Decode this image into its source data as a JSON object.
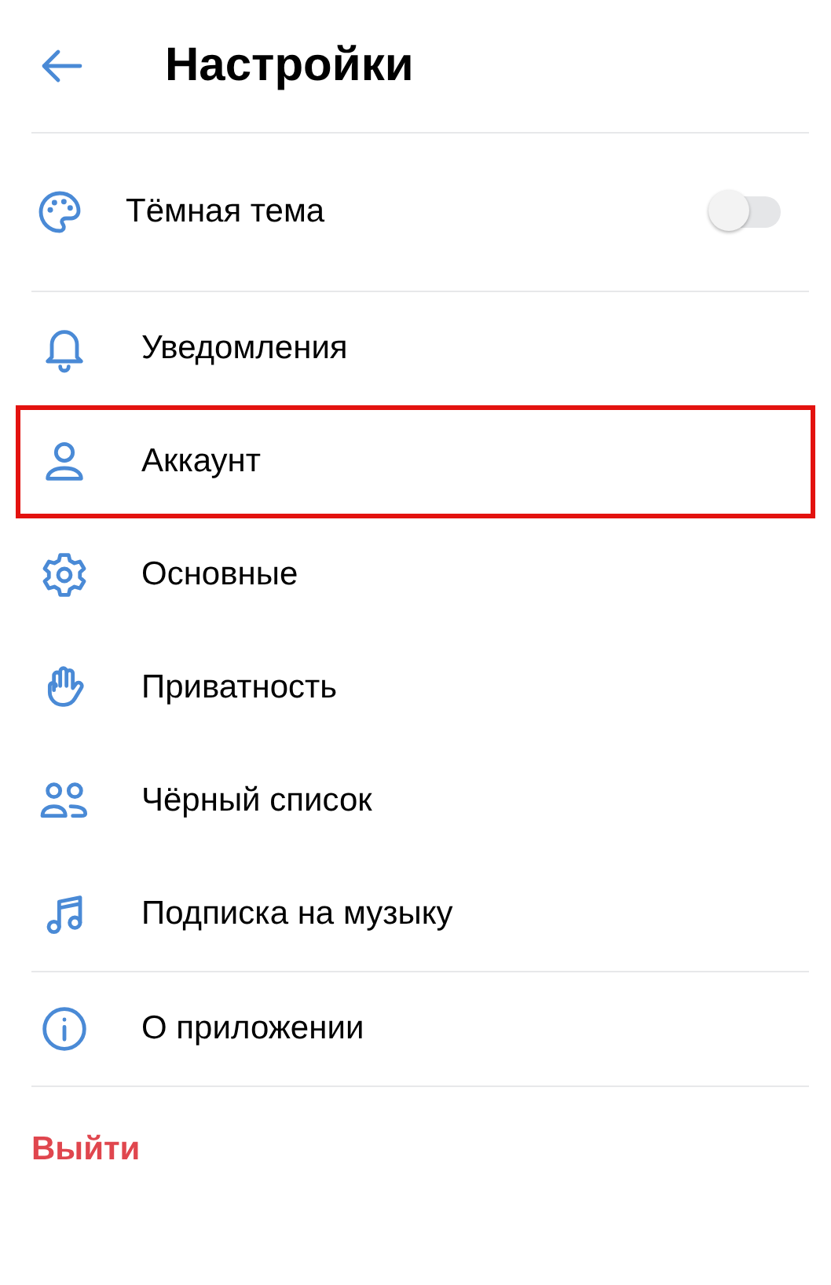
{
  "header": {
    "title": "Настройки"
  },
  "theme_row": {
    "label": "Тёмная тема",
    "on": false
  },
  "menu": [
    {
      "kind": "bell",
      "label": "Уведомления",
      "highlighted": false
    },
    {
      "kind": "person",
      "label": "Аккаунт",
      "highlighted": true
    },
    {
      "kind": "gear",
      "label": "Основные",
      "highlighted": false
    },
    {
      "kind": "hand",
      "label": "Приватность",
      "highlighted": false
    },
    {
      "kind": "people",
      "label": "Чёрный список",
      "highlighted": false
    },
    {
      "kind": "music",
      "label": "Подписка на музыку",
      "highlighted": false
    }
  ],
  "about": {
    "kind": "info",
    "label": "О приложении",
    "highlighted": false
  },
  "logout": {
    "label": "Выйти"
  }
}
